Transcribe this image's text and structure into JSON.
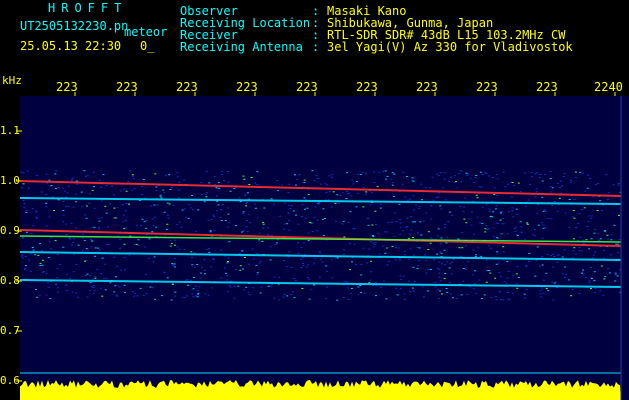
{
  "header": {
    "brand": "HROFFT",
    "filename": "UT2505132230.pn",
    "meteor_label": "meteor",
    "datetime": "25.05.13 22:30",
    "count": "0_"
  },
  "info": {
    "rows": [
      {
        "label": "Observer",
        "value": "Masaki Kano"
      },
      {
        "label": "Receiving Location",
        "value": "Shibukawa, Gunma, Japan"
      },
      {
        "label": "Receiver",
        "value": "RTL-SDR SDR# 43dB L15 103.2MHz CW"
      },
      {
        "label": "Receiving Antenna",
        "value": "3el Yagi(V) Az 330 for Vladivostok"
      }
    ],
    "separator": ":"
  },
  "axes": {
    "y_unit": "kHz",
    "y_ticks": [
      "1.1",
      "1.0",
      "0.9",
      "0.8",
      "0.7",
      "0.6"
    ],
    "x_ticks": [
      "223",
      "223",
      "223",
      "223",
      "223",
      "223",
      "223",
      "223",
      "223",
      "2240"
    ]
  },
  "colors": {
    "label_cyan": "#00ffff",
    "value_yellow": "#ffff00",
    "background": "#000000",
    "plot_bg": "#000040"
  }
}
